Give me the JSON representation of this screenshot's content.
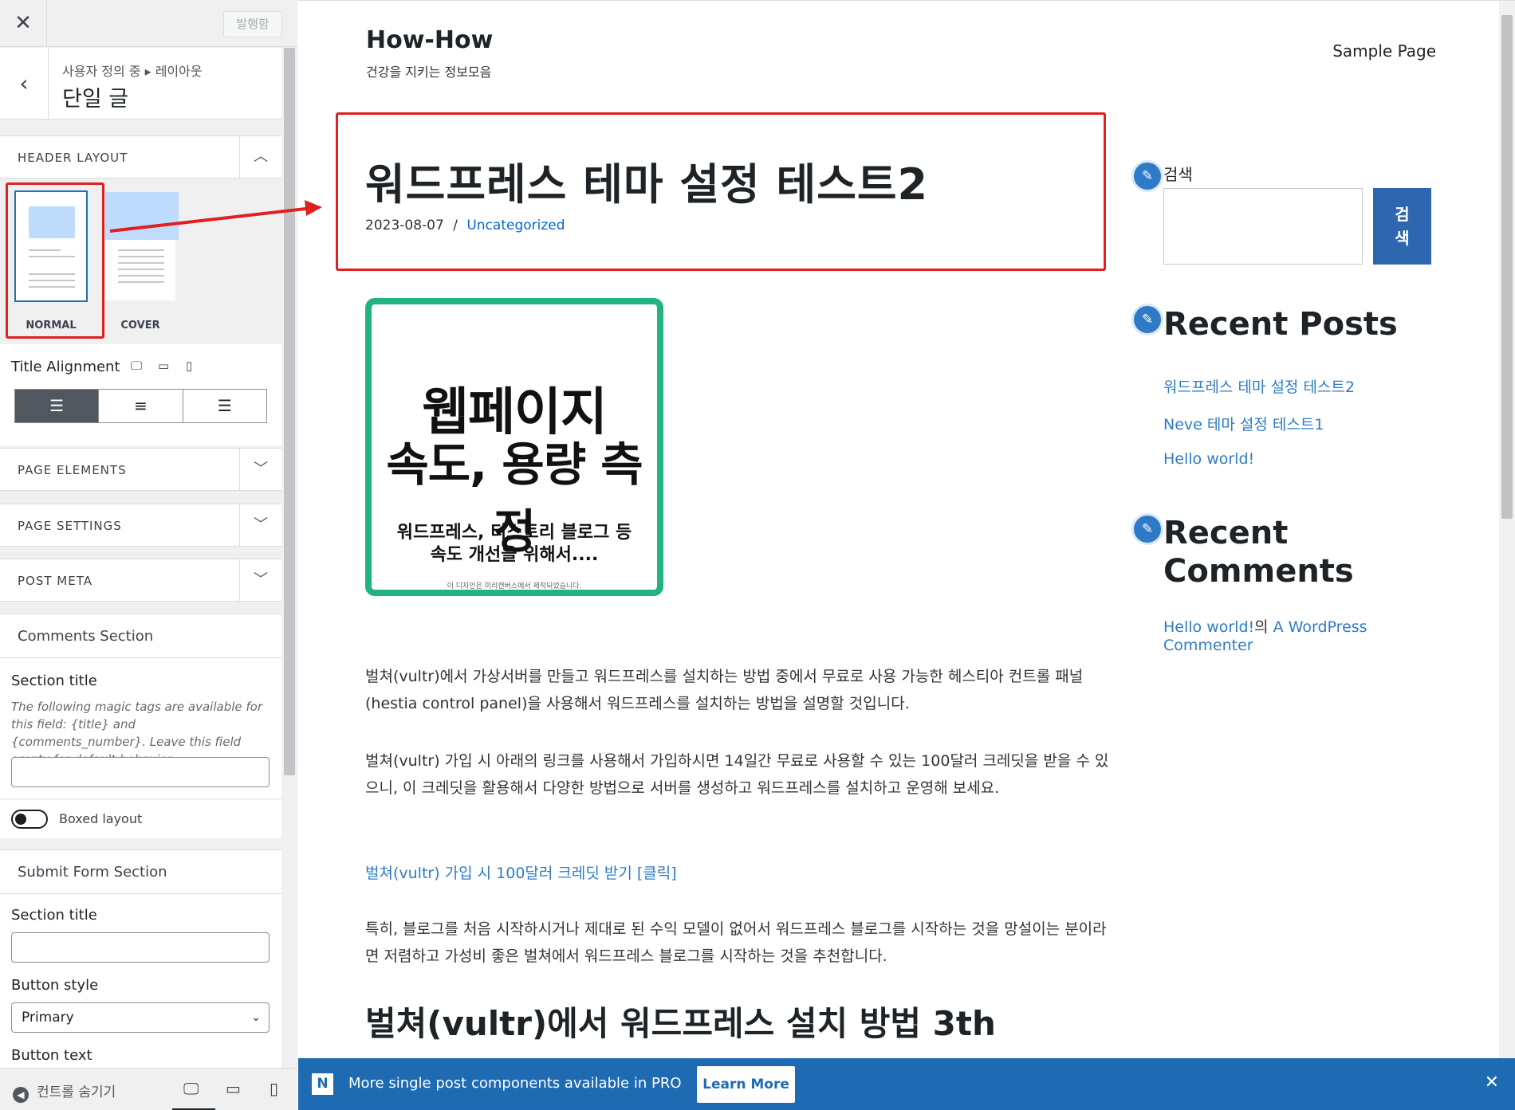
{
  "panel": {
    "publish_label": "발행함",
    "breadcrumb_path": "사용자 정의 중 ▸ 레이아웃",
    "section_title": "단일 글",
    "header_layout": {
      "label": "HEADER LAYOUT",
      "options": [
        {
          "name": "NORMAL",
          "selected": true
        },
        {
          "name": "COVER",
          "selected": false
        }
      ]
    },
    "title_alignment": {
      "label": "Title Alignment",
      "selected": "left"
    },
    "sections": [
      {
        "label": "PAGE ELEMENTS"
      },
      {
        "label": "PAGE SETTINGS"
      },
      {
        "label": "POST META"
      }
    ],
    "comments": {
      "heading": "Comments Section",
      "section_title_label": "Section title",
      "description": "The following magic tags are available for this field: {title} and {comments_number}. Leave this field empty for default behavior.",
      "section_title_value": "",
      "boxed_layout_label": "Boxed layout",
      "boxed_layout_on": false
    },
    "submit": {
      "heading": "Submit Form Section",
      "section_title_label": "Section title",
      "section_title_value": "",
      "button_style_label": "Button style",
      "button_style_value": "Primary",
      "button_text_label": "Button text"
    },
    "footer": {
      "hide_controls_label": "컨트롤 숨기기"
    }
  },
  "preview": {
    "site_title": "How-How",
    "site_tagline": "건강을 지키는 정보모음",
    "nav_item": "Sample Page",
    "post_title": "워드프레스 테마 설정 테스트2",
    "post_date": "2023-08-07",
    "post_separator": "/",
    "post_category": "Uncategorized",
    "featured_image": {
      "line1": "웹페이지",
      "line2": "속도, 용량 측정",
      "line3": "워드프레스, 티스토리 블로그 등",
      "line4": "속도 개선을 위해서....",
      "credit": "이 디자인은 미리캔버스에서 제작되었습니다.",
      "border_color": "#22b382"
    },
    "paragraphs": [
      "벌쳐(vultr)에서 가상서버를 만들고 워드프레스를 설치하는 방법 중에서 무료로 사용 가능한 헤스티아 컨트롤 패널(hestia control panel)을 사용해서 워드프레스를 설치하는 방법을 설명할 것입니다.",
      "벌쳐(vultr) 가입 시 아래의 링크를 사용해서 가입하시면 14일간 무료로 사용할 수 있는 100달러 크레딧을 받을 수 있으니, 이 크레딧을 활용해서 다양한 방법으로 서버를 생성하고 워드프레스를 설치하고 운영해 보세요.",
      "특히, 블로그를 처음 시작하시거나 제대로 된 수익 모델이 없어서 워드프레스 블로그를 시작하는 것을 망설이는 분이라면 저렴하고 가성비 좋은 벌쳐에서 워드프레스 블로그를 시작하는 것을 추천합니다."
    ],
    "promo_link": "벌쳐(vultr) 가입 시 100달러 크레딧 받기  [클릭]",
    "subheading": "벌쳐(vultr)에서 워드프레스 설치 방법 3th",
    "sidebar": {
      "search_label": "검색",
      "search_button": "검\n색",
      "recent_posts_heading": "Recent Posts",
      "recent_posts": [
        "워드프레스 테마 설정 테스트2",
        "Neve 테마 설정 테스트1",
        "Hello world!"
      ],
      "recent_comments_heading": "Recent Comments",
      "recent_comment_link1": "Hello world!",
      "recent_comment_joiner": "의 ",
      "recent_comment_author": "A WordPress Commenter"
    }
  },
  "banner": {
    "logo": "N",
    "message": "More single post components available in PRO",
    "button": "Learn More"
  },
  "colors": {
    "accent": "#2271b1",
    "link": "#2e7cc4",
    "banner": "#1e6ab3",
    "annotation": "#e02020"
  }
}
